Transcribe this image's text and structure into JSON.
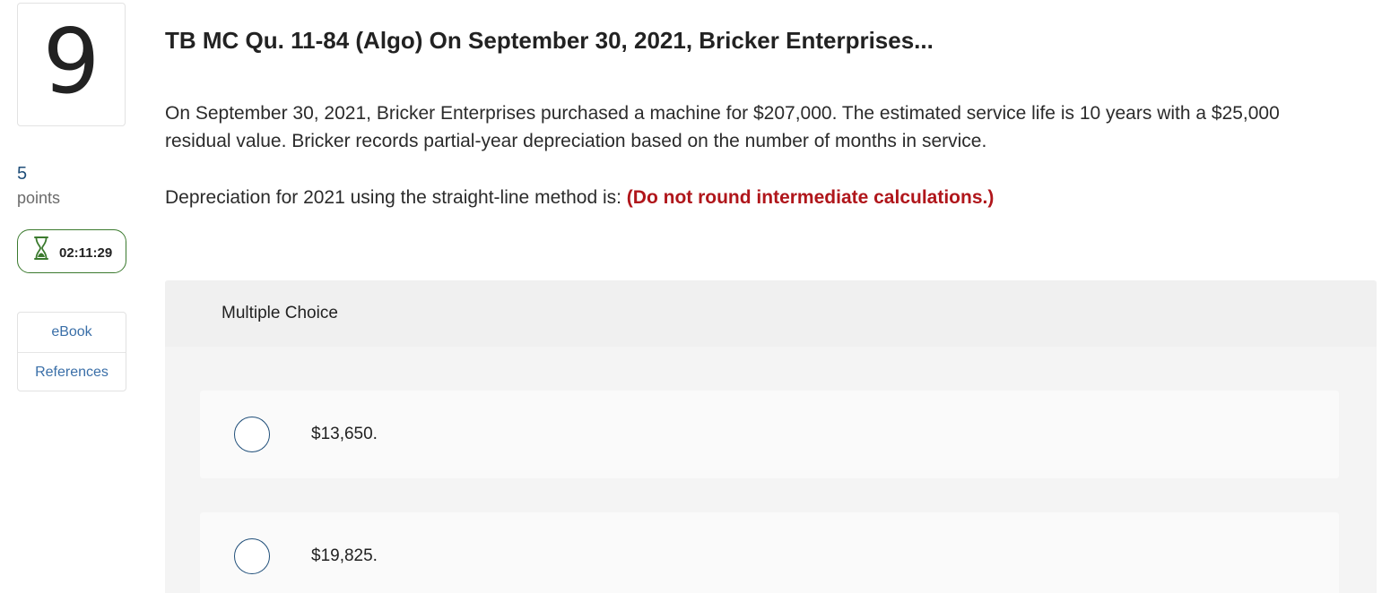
{
  "question": {
    "number": "9",
    "points_value": "5",
    "points_label": "points",
    "timer": "02:11:29",
    "title": "TB MC Qu. 11-84 (Algo) On September 30, 2021, Bricker Enterprises...",
    "body": "On September 30, 2021, Bricker Enterprises purchased a machine for $207,000. The estimated service life is 10 years with a $25,000 residual value. Bricker records partial-year depreciation based on the number of months in service.",
    "prompt": "Depreciation for 2021 using the straight-line method is: ",
    "prompt_note": "(Do not round intermediate calculations.)"
  },
  "resources": {
    "ebook": "eBook",
    "references": "References"
  },
  "multiple_choice": {
    "header": "Multiple Choice",
    "options": [
      "$13,650.",
      "$19,825."
    ]
  },
  "colors": {
    "accent_blue": "#1f4e79",
    "link_blue": "#3a6fa8",
    "note_red": "#b0161b",
    "timer_green": "#3b7a2e"
  },
  "icons": {
    "timer": "hourglass-icon"
  }
}
